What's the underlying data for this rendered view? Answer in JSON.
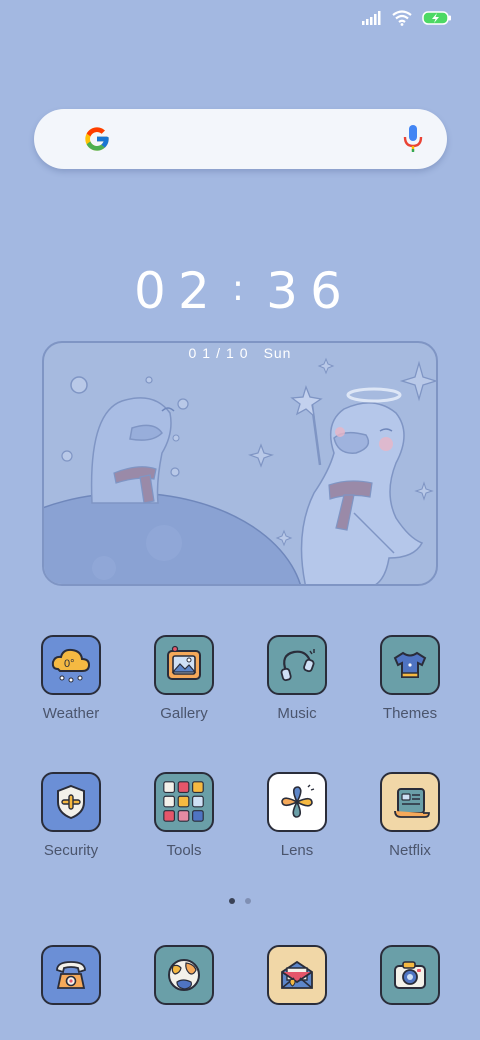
{
  "status": {
    "signal_icon": "signal-icon",
    "wifi_icon": "wifi-icon",
    "battery_icon": "battery-charging-icon"
  },
  "search": {
    "logo": "google-g-logo",
    "mic_icon": "mic-icon"
  },
  "clock": {
    "hour1": "0",
    "hour2": "2",
    "separator": ":",
    "min1": "3",
    "min2": "6"
  },
  "widget": {
    "date": "01/10",
    "day": "Sun"
  },
  "apps_row1": [
    {
      "label": "Weather",
      "icon": "weather-cloud-icon",
      "color": "#6b8fd6"
    },
    {
      "label": "Gallery",
      "icon": "gallery-frame-icon",
      "color": "#6a9fa8"
    },
    {
      "label": "Music",
      "icon": "headphones-icon",
      "color": "#6a9fa8"
    },
    {
      "label": "Themes",
      "icon": "tshirt-icon",
      "color": "#6a9fa8"
    }
  ],
  "apps_row2": [
    {
      "label": "Security",
      "icon": "shield-icon",
      "color": "#6b8fd6"
    },
    {
      "label": "Tools",
      "icon": "tools-grid-icon",
      "color": "#6a9fa8"
    },
    {
      "label": "Lens",
      "icon": "pinwheel-icon",
      "color": "#ffffff"
    },
    {
      "label": "Netflix",
      "icon": "scroll-icon",
      "color": "#f1d7a7"
    }
  ],
  "dock": [
    {
      "icon": "telephone-icon",
      "color": "#6b8fd6"
    },
    {
      "icon": "globe-icon",
      "color": "#6a9fa8"
    },
    {
      "icon": "envelope-icon",
      "color": "#f1d7a7"
    },
    {
      "icon": "camera-icon",
      "color": "#6a9fa8"
    }
  ],
  "page_indicator": {
    "count": 2,
    "active": 0
  }
}
